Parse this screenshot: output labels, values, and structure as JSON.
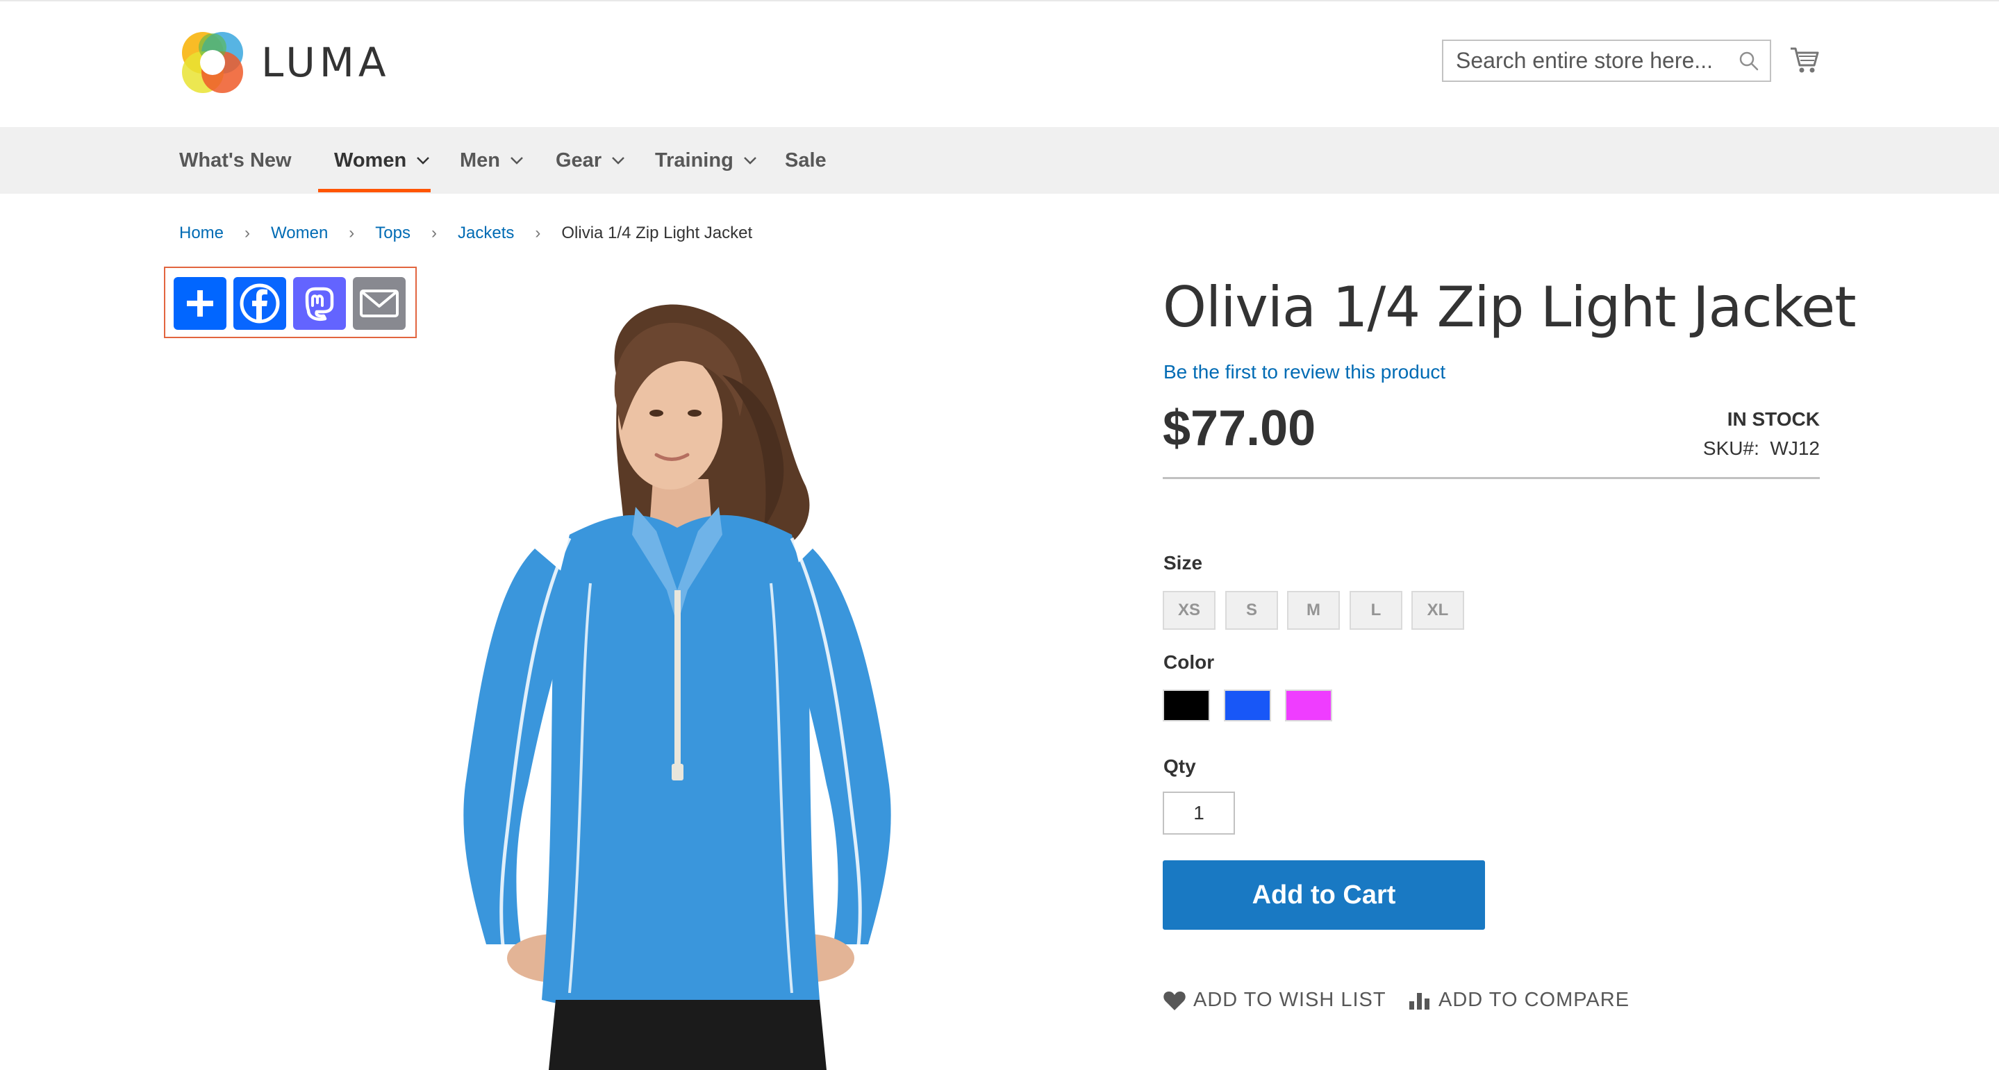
{
  "header": {
    "logo_text": "LUMA",
    "search": {
      "placeholder": "Search entire store here..."
    },
    "icons": {
      "search": "search-icon",
      "cart": "cart-icon"
    }
  },
  "nav": {
    "items": [
      {
        "label": "What's New",
        "has_dropdown": false
      },
      {
        "label": "Women",
        "has_dropdown": true,
        "active": true
      },
      {
        "label": "Men",
        "has_dropdown": true
      },
      {
        "label": "Gear",
        "has_dropdown": true
      },
      {
        "label": "Training",
        "has_dropdown": true
      },
      {
        "label": "Sale",
        "has_dropdown": false
      }
    ],
    "active_color": "#ff5501"
  },
  "breadcrumb": {
    "items": [
      "Home",
      "Women",
      "Tops",
      "Jackets"
    ],
    "current": "Olivia 1/4 Zip Light Jacket",
    "separator": "›"
  },
  "share": {
    "buttons": [
      {
        "name": "share-plus",
        "icon": "plus-icon",
        "color": "#0166ff"
      },
      {
        "name": "share-facebook",
        "icon": "facebook-icon",
        "color": "#0866ff"
      },
      {
        "name": "share-mastodon",
        "icon": "mastodon-icon",
        "color": "#6364ff"
      },
      {
        "name": "share-email",
        "icon": "email-icon",
        "color": "#888990"
      }
    ]
  },
  "product": {
    "title": "Olivia 1/4 Zip Light Jacket",
    "review_link": "Be the first to review this product",
    "price": "$77.00",
    "stock": "IN STOCK",
    "sku_label": "SKU#:",
    "sku_value": "WJ12",
    "size_label": "Size",
    "sizes": [
      "XS",
      "S",
      "M",
      "L",
      "XL"
    ],
    "color_label": "Color",
    "colors": [
      {
        "name": "Black",
        "hex": "#000000"
      },
      {
        "name": "Blue",
        "hex": "#1857f7"
      },
      {
        "name": "Purple",
        "hex": "#ef3dff"
      }
    ],
    "qty_label": "Qty",
    "qty_value": "1",
    "add_to_cart": "Add to Cart",
    "wish_list": "ADD TO WISH LIST",
    "compare": "ADD TO COMPARE"
  }
}
